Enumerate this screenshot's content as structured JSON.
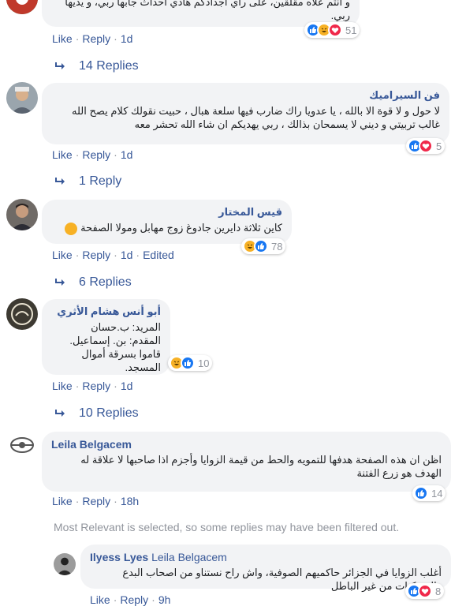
{
  "colors": {
    "link": "#385898",
    "muted": "#90949c",
    "bubble": "#f2f3f5",
    "like": "#1877f2",
    "love": "#f0284a",
    "haha": "#f7b125"
  },
  "comments": [
    {
      "author": "",
      "text": "و أنتم علاه مقلقين، على رأي أجدادكم هاذي أحداث جابها ربي، و يديها ربي.",
      "actions": {
        "like": "Like",
        "reply": "Reply",
        "time": "1d"
      },
      "reactions": {
        "icons": [
          "like-icon",
          "haha-icon",
          "love-icon"
        ],
        "count": "51"
      },
      "replies_label": "14 Replies"
    },
    {
      "author": "فن السيراميك",
      "text": "لا حول و لا قوة الا بالله ، يا عدويا راك ضارب فيها سلعة هبال ، حبيت نقولك كلام يصح الله غالب تربيتي و ديني لا يسمحان بذالك ، ربي يهديكم ان شاء الله تحشر معه",
      "actions": {
        "like": "Like",
        "reply": "Reply",
        "time": "1d"
      },
      "reactions": {
        "icons": [
          "like-icon",
          "love-icon"
        ],
        "count": "5"
      },
      "replies_label": "1 Reply"
    },
    {
      "author": "قيس المختار",
      "text": "كاين ثلاثة دايرين جادوغ زوج مهابل ومولا الصفحة",
      "actions": {
        "like": "Like",
        "reply": "Reply",
        "time": "1d",
        "edited": "Edited"
      },
      "reactions": {
        "icons": [
          "haha-icon",
          "like-icon"
        ],
        "count": "78"
      },
      "replies_label": "6 Replies"
    },
    {
      "author": "أبو أنس هشام الأثري",
      "lines": [
        "المريد: ب.حسان",
        "المقدم: بن. إسماعيل.",
        "قاموا بسرقة أموال المسجد."
      ],
      "actions": {
        "like": "Like",
        "reply": "Reply",
        "time": "1d"
      },
      "reactions": {
        "icons": [
          "haha-icon",
          "like-icon"
        ],
        "count": "10"
      },
      "replies_label": "10 Replies"
    },
    {
      "author": "Leila Belgacem",
      "text": "اظن ان هذه الصفحة هدفها للتمويه والحط من قيمة الزوايا وأجزم اذا صاحبها لا علاقة له الهدف هو زرع الفتنة",
      "actions": {
        "like": "Like",
        "reply": "Reply",
        "time": "18h"
      },
      "reactions": {
        "icons": [
          "like-icon"
        ],
        "count": "14"
      }
    }
  ],
  "notice": "Most Relevant is selected, so some replies may have been filtered out.",
  "reply": {
    "author": "Ilyess Lyes",
    "mention": "Leila Belgacem",
    "text": "أغلب الزوايا في الجزائر حاكميهم الصوفية، واش راح نستناو من اصحاب البدع والشركيات من غير الباطل",
    "actions": {
      "like": "Like",
      "reply": "Reply",
      "time": "9h"
    },
    "reactions": {
      "icons": [
        "like-icon",
        "love-icon"
      ],
      "count": "8"
    }
  }
}
